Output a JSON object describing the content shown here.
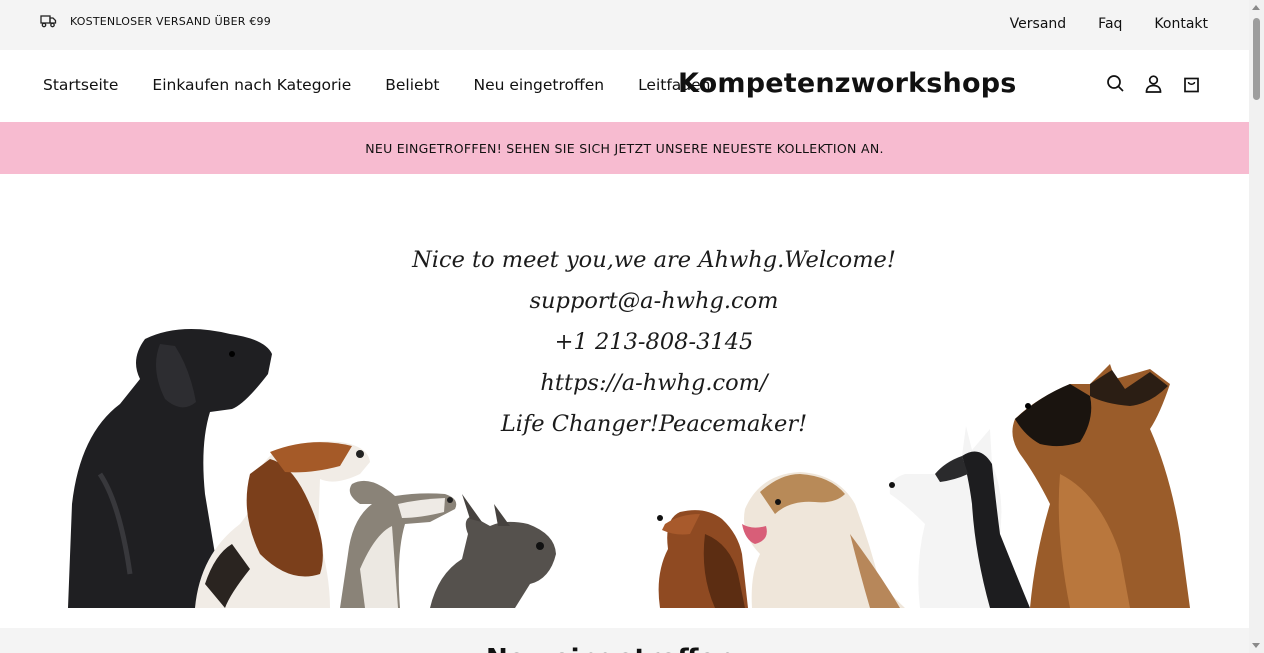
{
  "topbar": {
    "shipping_text": "KOSTENLOSER VERSAND ÜBER €99",
    "shipping_icon": "truck-icon",
    "links": [
      "Versand",
      "Faq",
      "Kontakt"
    ]
  },
  "header": {
    "nav": [
      "Startseite",
      "Einkaufen nach Kategorie",
      "Beliebt",
      "Neu eingetroffen",
      "Leitfaden"
    ],
    "brand": "Kompetenzworkshops",
    "icons": [
      "search-icon",
      "account-icon",
      "cart-icon"
    ]
  },
  "announcement": {
    "text": "NEU EINGETROFFEN! SEHEN SIE SICH JETZT UNSERE NEUESTE KOLLEKTION AN.",
    "background": "#f7bbd0"
  },
  "hero": {
    "lines": [
      "Nice to meet you,we are Ahwhg.Welcome!",
      "support@a-hwhg.com",
      "+1 213-808-3145",
      "https://a-hwhg.com/",
      "Life Changer!Peacemaker!"
    ],
    "image_description_icon": "dogs-illustration"
  },
  "section": {
    "heading_partial": "Neu eingetroffen"
  }
}
